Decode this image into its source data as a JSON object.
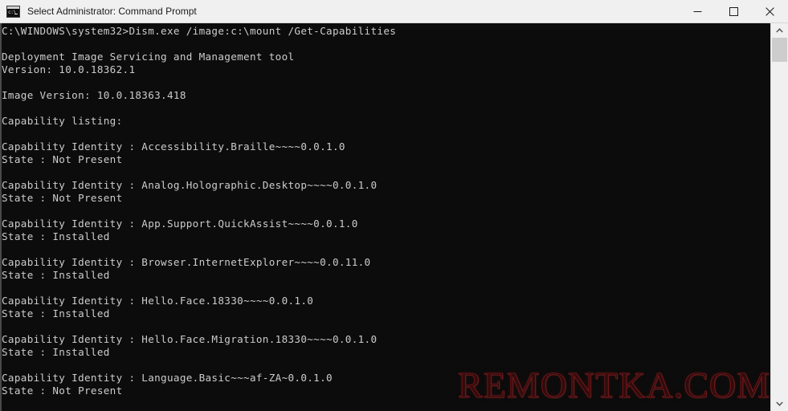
{
  "window": {
    "title": "Select Administrator: Command Prompt",
    "icon": "cmd-console-icon",
    "icon_prompt_text": "c:\\",
    "colors": {
      "titlebar_bg": "#f0f0f0",
      "titlebar_text": "#1b1b1b",
      "console_bg": "#0c0c0c",
      "console_text": "#cccccc",
      "watermark": "#961c1e",
      "scrollbar_track": "#f0f0f0",
      "scrollbar_thumb": "#cdcdcd"
    },
    "controls": {
      "minimize": "—",
      "maximize": "□",
      "close": "✕"
    }
  },
  "console": {
    "prompt_path": "C:\\WINDOWS\\system32>",
    "command": "Dism.exe /image:c:\\mount /Get-Capabilities",
    "tool_name": "Deployment Image Servicing and Management tool",
    "tool_version_line": "Version: 10.0.18362.1",
    "image_version_line": "Image Version: 10.0.18363.418",
    "listing_header": "Capability listing:",
    "identity_label": "Capability Identity",
    "state_label": "State",
    "capabilities": [
      {
        "identity": "Accessibility.Braille~~~~0.0.1.0",
        "state": "Not Present"
      },
      {
        "identity": "Analog.Holographic.Desktop~~~~0.0.1.0",
        "state": "Not Present"
      },
      {
        "identity": "App.Support.QuickAssist~~~~0.0.1.0",
        "state": "Installed"
      },
      {
        "identity": "Browser.InternetExplorer~~~~0.0.11.0",
        "state": "Installed"
      },
      {
        "identity": "Hello.Face.18330~~~~0.0.1.0",
        "state": "Installed"
      },
      {
        "identity": "Hello.Face.Migration.18330~~~~0.0.1.0",
        "state": "Installed"
      },
      {
        "identity": "Language.Basic~~~af-ZA~0.0.1.0",
        "state": "Not Present"
      }
    ],
    "full_text": "C:\\WINDOWS\\system32>Dism.exe /image:c:\\mount /Get-Capabilities\n\nDeployment Image Servicing and Management tool\nVersion: 10.0.18362.1\n\nImage Version: 10.0.18363.418\n\nCapability listing:\n\nCapability Identity : Accessibility.Braille~~~~0.0.1.0\nState : Not Present\n\nCapability Identity : Analog.Holographic.Desktop~~~~0.0.1.0\nState : Not Present\n\nCapability Identity : App.Support.QuickAssist~~~~0.0.1.0\nState : Installed\n\nCapability Identity : Browser.InternetExplorer~~~~0.0.11.0\nState : Installed\n\nCapability Identity : Hello.Face.18330~~~~0.0.1.0\nState : Installed\n\nCapability Identity : Hello.Face.Migration.18330~~~~0.0.1.0\nState : Installed\n\nCapability Identity : Language.Basic~~~af-ZA~0.0.1.0\nState : Not Present"
  },
  "watermark": {
    "text": "REMONTKA.COM"
  },
  "scrollbar": {
    "up_arrow": "˄",
    "down_arrow": "˅"
  }
}
